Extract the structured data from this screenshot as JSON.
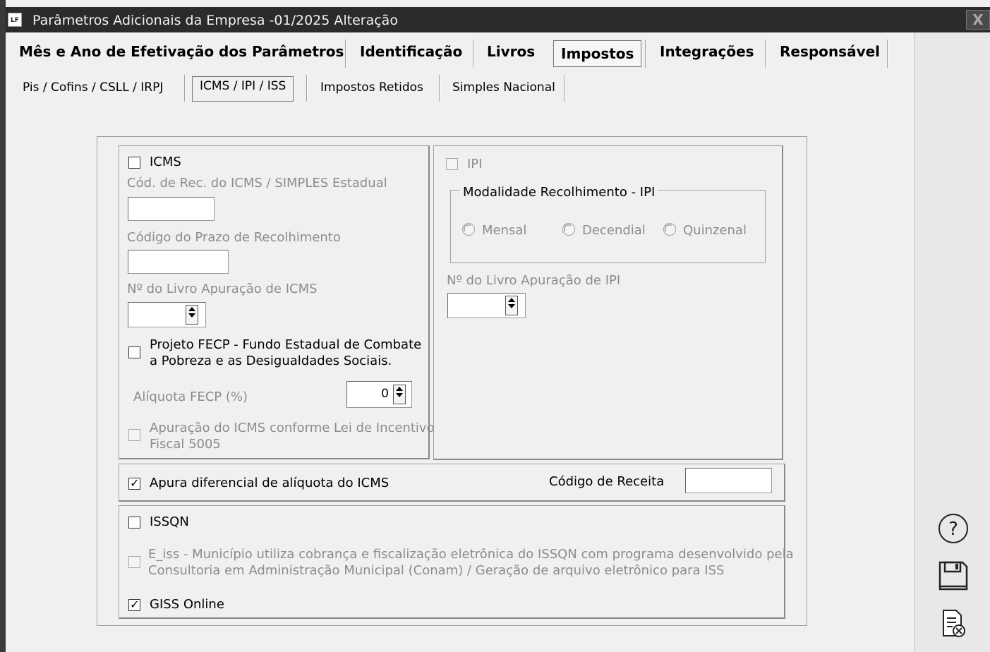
{
  "window": {
    "title": "Parâmetros Adicionais da Empresa -01/2025 Alteração",
    "app_icon": "LF",
    "close_label": "X"
  },
  "main_tabs": [
    {
      "label": "Mês e Ano de Efetivação dos Parâmetros"
    },
    {
      "label": "Identificação"
    },
    {
      "label": "Livros"
    },
    {
      "label": "Impostos"
    },
    {
      "label": "Integrações"
    },
    {
      "label": "Responsável"
    }
  ],
  "sub_tabs": [
    {
      "label": "Pis / Cofins / CSLL / IRPJ"
    },
    {
      "label": "ICMS / IPI / ISS"
    },
    {
      "label": "Impostos Retidos"
    },
    {
      "label": "Simples Nacional"
    }
  ],
  "icms": {
    "checkbox_label": "ICMS",
    "checked": false,
    "cod_rec_label": "Cód. de Rec. do ICMS / SIMPLES Estadual",
    "cod_rec_value": "",
    "prazo_label": "Código do Prazo de Recolhimento",
    "prazo_value": "",
    "livro_label": "Nº do Livro Apuração de ICMS",
    "livro_value": "",
    "fecp_label_line1": "Projeto FECP - Fundo Estadual de Combate",
    "fecp_label_line2": "a Pobreza e as Desigualdades Sociais.",
    "fecp_checked": false,
    "aliquota_label": "Alíquota FECP (%)",
    "aliquota_value": "0",
    "incentivo_label_line1": "Apuração do ICMS conforme Lei de Incentivo",
    "incentivo_label_line2": "Fiscal 5005",
    "incentivo_checked": false
  },
  "ipi": {
    "checkbox_label": "IPI",
    "checked": false,
    "modalidade_title": "Modalidade Recolhimento - IPI",
    "options": [
      "Mensal",
      "Decendial",
      "Quinzenal"
    ],
    "livro_label": "Nº do Livro Apuração de IPI",
    "livro_value": ""
  },
  "difal": {
    "checkbox_label": "Apura diferencial de alíquota do ICMS",
    "checked": true,
    "codigo_receita_label": "Código de Receita",
    "codigo_receita_value": ""
  },
  "iss": {
    "issqn_label": "ISSQN",
    "issqn_checked": false,
    "eiss_label_line1": "E_iss - Município utiliza cobrança e fiscalização eletrônica do ISSQN com programa desenvolvido pela",
    "eiss_label_line2": "Consultoria em Administração Municipal (Conam) / Geração de arquivo eletrônico para ISS",
    "eiss_checked": false,
    "giss_label": "GISS Online",
    "giss_checked": true
  },
  "side_buttons": [
    "help-icon",
    "save-icon",
    "cancel-document-icon"
  ],
  "check_mark": "✓"
}
